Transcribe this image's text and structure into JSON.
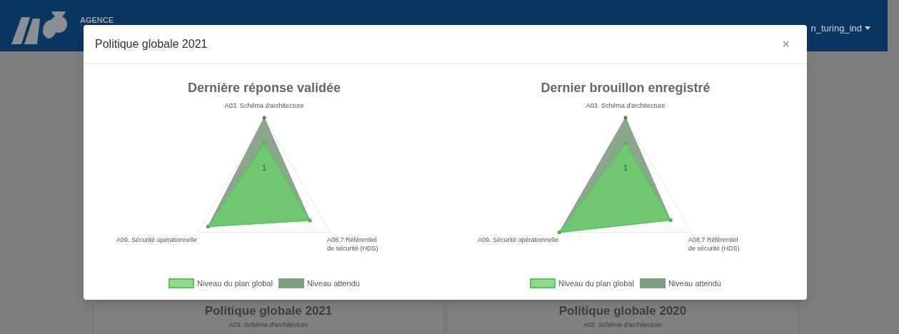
{
  "header": {
    "logo_text": "AGENCE",
    "user_menu": "n_turing_ind"
  },
  "background_cards": [
    {
      "title": "Politique globale 2021",
      "axis_label": "A03. Schéma d'architecture"
    },
    {
      "title": "Politique globale 2020",
      "axis_label": "A03. Schéma d'architecture"
    }
  ],
  "modal": {
    "title": "Politique globale 2021",
    "close": "×",
    "charts": [
      {
        "title": "Dernière réponse validée",
        "tick_label": "1",
        "axes": [
          {
            "lines": [
              "A03. Schéma d'architecture"
            ]
          },
          {
            "lines": [
              "A09. Sécurité opérationnelle"
            ]
          },
          {
            "lines": [
              "A08.7 Référentiel",
              "de sécurité (HDS)"
            ]
          }
        ],
        "legend": [
          {
            "label": "Niveau du plan global",
            "color": "#8fd98f"
          },
          {
            "label": "Niveau attendu",
            "color": "#7e9c80"
          }
        ]
      },
      {
        "title": "Dernier brouillon enregistré",
        "tick_label": "1",
        "axes": [
          {
            "lines": [
              "A03. Schéma d'architecture"
            ]
          },
          {
            "lines": [
              "A09. Sécurité opérationnelle"
            ]
          },
          {
            "lines": [
              "A08.7 Référentiel",
              "de sécurité (HDS)"
            ]
          }
        ],
        "legend": [
          {
            "label": "Niveau du plan global",
            "color": "#8fd98f"
          },
          {
            "label": "Niveau attendu",
            "color": "#7e9c80"
          }
        ]
      }
    ]
  }
}
